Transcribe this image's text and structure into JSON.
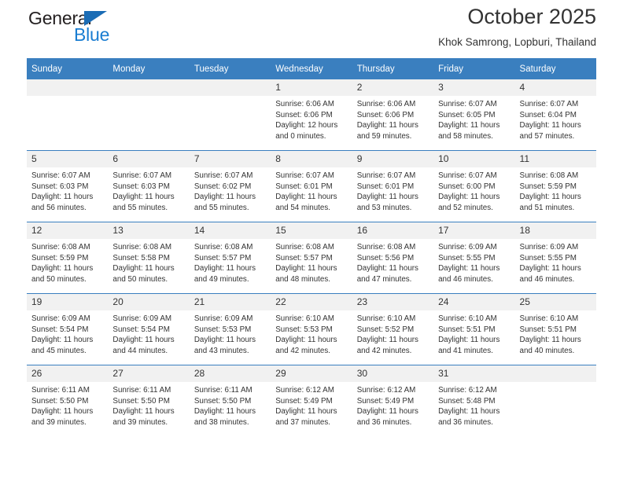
{
  "brand": {
    "name_dark": "General",
    "name_blue": "Blue",
    "triangle_color": "#1a6cb5",
    "blue_color": "#1a7dd1"
  },
  "header": {
    "title": "October 2025",
    "subtitle": "Khok Samrong, Lopburi, Thailand"
  },
  "theme": {
    "header_bg": "#3a7fbf",
    "daynum_bg": "#f1f1f1",
    "rule_color": "#3a7fbf"
  },
  "calendar": {
    "weekday_headers": [
      "Sunday",
      "Monday",
      "Tuesday",
      "Wednesday",
      "Thursday",
      "Friday",
      "Saturday"
    ],
    "weeks": [
      [
        {
          "day": "",
          "sunrise": "",
          "sunset": "",
          "daylight_1": "",
          "daylight_2": ""
        },
        {
          "day": "",
          "sunrise": "",
          "sunset": "",
          "daylight_1": "",
          "daylight_2": ""
        },
        {
          "day": "",
          "sunrise": "",
          "sunset": "",
          "daylight_1": "",
          "daylight_2": ""
        },
        {
          "day": "1",
          "sunrise": "Sunrise: 6:06 AM",
          "sunset": "Sunset: 6:06 PM",
          "daylight_1": "Daylight: 12 hours",
          "daylight_2": "and 0 minutes."
        },
        {
          "day": "2",
          "sunrise": "Sunrise: 6:06 AM",
          "sunset": "Sunset: 6:06 PM",
          "daylight_1": "Daylight: 11 hours",
          "daylight_2": "and 59 minutes."
        },
        {
          "day": "3",
          "sunrise": "Sunrise: 6:07 AM",
          "sunset": "Sunset: 6:05 PM",
          "daylight_1": "Daylight: 11 hours",
          "daylight_2": "and 58 minutes."
        },
        {
          "day": "4",
          "sunrise": "Sunrise: 6:07 AM",
          "sunset": "Sunset: 6:04 PM",
          "daylight_1": "Daylight: 11 hours",
          "daylight_2": "and 57 minutes."
        }
      ],
      [
        {
          "day": "5",
          "sunrise": "Sunrise: 6:07 AM",
          "sunset": "Sunset: 6:03 PM",
          "daylight_1": "Daylight: 11 hours",
          "daylight_2": "and 56 minutes."
        },
        {
          "day": "6",
          "sunrise": "Sunrise: 6:07 AM",
          "sunset": "Sunset: 6:03 PM",
          "daylight_1": "Daylight: 11 hours",
          "daylight_2": "and 55 minutes."
        },
        {
          "day": "7",
          "sunrise": "Sunrise: 6:07 AM",
          "sunset": "Sunset: 6:02 PM",
          "daylight_1": "Daylight: 11 hours",
          "daylight_2": "and 55 minutes."
        },
        {
          "day": "8",
          "sunrise": "Sunrise: 6:07 AM",
          "sunset": "Sunset: 6:01 PM",
          "daylight_1": "Daylight: 11 hours",
          "daylight_2": "and 54 minutes."
        },
        {
          "day": "9",
          "sunrise": "Sunrise: 6:07 AM",
          "sunset": "Sunset: 6:01 PM",
          "daylight_1": "Daylight: 11 hours",
          "daylight_2": "and 53 minutes."
        },
        {
          "day": "10",
          "sunrise": "Sunrise: 6:07 AM",
          "sunset": "Sunset: 6:00 PM",
          "daylight_1": "Daylight: 11 hours",
          "daylight_2": "and 52 minutes."
        },
        {
          "day": "11",
          "sunrise": "Sunrise: 6:08 AM",
          "sunset": "Sunset: 5:59 PM",
          "daylight_1": "Daylight: 11 hours",
          "daylight_2": "and 51 minutes."
        }
      ],
      [
        {
          "day": "12",
          "sunrise": "Sunrise: 6:08 AM",
          "sunset": "Sunset: 5:59 PM",
          "daylight_1": "Daylight: 11 hours",
          "daylight_2": "and 50 minutes."
        },
        {
          "day": "13",
          "sunrise": "Sunrise: 6:08 AM",
          "sunset": "Sunset: 5:58 PM",
          "daylight_1": "Daylight: 11 hours",
          "daylight_2": "and 50 minutes."
        },
        {
          "day": "14",
          "sunrise": "Sunrise: 6:08 AM",
          "sunset": "Sunset: 5:57 PM",
          "daylight_1": "Daylight: 11 hours",
          "daylight_2": "and 49 minutes."
        },
        {
          "day": "15",
          "sunrise": "Sunrise: 6:08 AM",
          "sunset": "Sunset: 5:57 PM",
          "daylight_1": "Daylight: 11 hours",
          "daylight_2": "and 48 minutes."
        },
        {
          "day": "16",
          "sunrise": "Sunrise: 6:08 AM",
          "sunset": "Sunset: 5:56 PM",
          "daylight_1": "Daylight: 11 hours",
          "daylight_2": "and 47 minutes."
        },
        {
          "day": "17",
          "sunrise": "Sunrise: 6:09 AM",
          "sunset": "Sunset: 5:55 PM",
          "daylight_1": "Daylight: 11 hours",
          "daylight_2": "and 46 minutes."
        },
        {
          "day": "18",
          "sunrise": "Sunrise: 6:09 AM",
          "sunset": "Sunset: 5:55 PM",
          "daylight_1": "Daylight: 11 hours",
          "daylight_2": "and 46 minutes."
        }
      ],
      [
        {
          "day": "19",
          "sunrise": "Sunrise: 6:09 AM",
          "sunset": "Sunset: 5:54 PM",
          "daylight_1": "Daylight: 11 hours",
          "daylight_2": "and 45 minutes."
        },
        {
          "day": "20",
          "sunrise": "Sunrise: 6:09 AM",
          "sunset": "Sunset: 5:54 PM",
          "daylight_1": "Daylight: 11 hours",
          "daylight_2": "and 44 minutes."
        },
        {
          "day": "21",
          "sunrise": "Sunrise: 6:09 AM",
          "sunset": "Sunset: 5:53 PM",
          "daylight_1": "Daylight: 11 hours",
          "daylight_2": "and 43 minutes."
        },
        {
          "day": "22",
          "sunrise": "Sunrise: 6:10 AM",
          "sunset": "Sunset: 5:53 PM",
          "daylight_1": "Daylight: 11 hours",
          "daylight_2": "and 42 minutes."
        },
        {
          "day": "23",
          "sunrise": "Sunrise: 6:10 AM",
          "sunset": "Sunset: 5:52 PM",
          "daylight_1": "Daylight: 11 hours",
          "daylight_2": "and 42 minutes."
        },
        {
          "day": "24",
          "sunrise": "Sunrise: 6:10 AM",
          "sunset": "Sunset: 5:51 PM",
          "daylight_1": "Daylight: 11 hours",
          "daylight_2": "and 41 minutes."
        },
        {
          "day": "25",
          "sunrise": "Sunrise: 6:10 AM",
          "sunset": "Sunset: 5:51 PM",
          "daylight_1": "Daylight: 11 hours",
          "daylight_2": "and 40 minutes."
        }
      ],
      [
        {
          "day": "26",
          "sunrise": "Sunrise: 6:11 AM",
          "sunset": "Sunset: 5:50 PM",
          "daylight_1": "Daylight: 11 hours",
          "daylight_2": "and 39 minutes."
        },
        {
          "day": "27",
          "sunrise": "Sunrise: 6:11 AM",
          "sunset": "Sunset: 5:50 PM",
          "daylight_1": "Daylight: 11 hours",
          "daylight_2": "and 39 minutes."
        },
        {
          "day": "28",
          "sunrise": "Sunrise: 6:11 AM",
          "sunset": "Sunset: 5:50 PM",
          "daylight_1": "Daylight: 11 hours",
          "daylight_2": "and 38 minutes."
        },
        {
          "day": "29",
          "sunrise": "Sunrise: 6:12 AM",
          "sunset": "Sunset: 5:49 PM",
          "daylight_1": "Daylight: 11 hours",
          "daylight_2": "and 37 minutes."
        },
        {
          "day": "30",
          "sunrise": "Sunrise: 6:12 AM",
          "sunset": "Sunset: 5:49 PM",
          "daylight_1": "Daylight: 11 hours",
          "daylight_2": "and 36 minutes."
        },
        {
          "day": "31",
          "sunrise": "Sunrise: 6:12 AM",
          "sunset": "Sunset: 5:48 PM",
          "daylight_1": "Daylight: 11 hours",
          "daylight_2": "and 36 minutes."
        },
        {
          "day": "",
          "sunrise": "",
          "sunset": "",
          "daylight_1": "",
          "daylight_2": ""
        }
      ]
    ]
  }
}
